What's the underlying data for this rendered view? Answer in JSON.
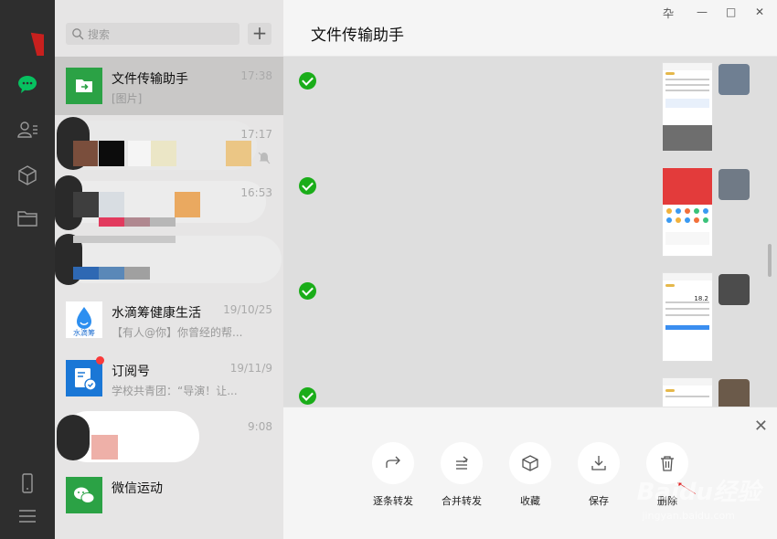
{
  "nav": {
    "icons": [
      "avatar",
      "chat-icon",
      "contacts-icon",
      "box-icon",
      "folder-icon",
      "phone-icon",
      "menu-icon"
    ]
  },
  "search": {
    "placeholder": "搜索",
    "add_label": "+"
  },
  "chats": [
    {
      "name": "文件传输助手",
      "time": "17:38",
      "preview": "[图片]",
      "icon": "file-transfer-icon",
      "color": "#2ba245",
      "active": true
    },
    {
      "name": "",
      "time": "17:17",
      "preview": "",
      "icon": "blurred-avatar"
    },
    {
      "name": "",
      "time": "16:53",
      "preview": "",
      "icon": "blurred-avatar"
    },
    {
      "name": "",
      "time": "",
      "preview": "",
      "icon": "blurred-avatar"
    },
    {
      "name": "水滴筹健康生活",
      "time": "19/10/25",
      "preview": "【有人@你】你曾经的帮...",
      "icon": "shuidichou-logo",
      "logo_text": "水滴筹"
    },
    {
      "name": "订阅号",
      "time": "19/11/9",
      "preview": "学校共青团：“导演！让...",
      "icon": "subscription-icon",
      "color": "#1a77d6"
    },
    {
      "name": "",
      "time": "9:08",
      "preview": "",
      "icon": "blurred-avatar"
    },
    {
      "name": "微信运动",
      "time": "",
      "preview": "",
      "icon": "wechat-sport-icon",
      "color": "#2ba245"
    }
  ],
  "header": {
    "title": "文件传输助手",
    "pin": "卆",
    "minimize": "—",
    "maximize": "□",
    "close": "✕"
  },
  "actions": {
    "close": "✕",
    "items": [
      {
        "label": "逐条转发",
        "icon": "forward-one-icon"
      },
      {
        "label": "合并转发",
        "icon": "forward-merge-icon"
      },
      {
        "label": "收藏",
        "icon": "favorite-icon"
      },
      {
        "label": "保存",
        "icon": "save-icon"
      },
      {
        "label": "删除",
        "icon": "delete-icon"
      }
    ]
  },
  "shots": [
    {
      "value": ""
    },
    {
      "value": ""
    },
    {
      "value": "18.2"
    },
    {
      "value": ""
    }
  ],
  "watermark": {
    "brand": "Baidu经验",
    "url": "jingyan.baidu.com"
  },
  "colors": {
    "accent": "#1aad19",
    "nav_bg": "#2e2e2e",
    "list_bg": "#e6e5e5",
    "arrow": "#e02020"
  }
}
